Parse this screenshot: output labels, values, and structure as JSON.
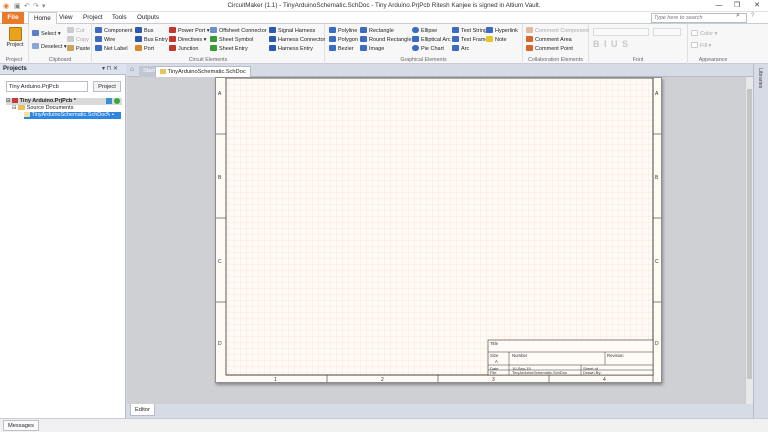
{
  "window": {
    "title": "CircuitMaker (1.1) - TinyArduinoSchematic.SchDoc - Tiny Arduino.PrjPcb Ritesh Kanjee is signed in Altium Vault.",
    "minimize": "—",
    "restore": "❐",
    "close": "✕"
  },
  "ribbon_tabs": {
    "file": "File",
    "home": "Home",
    "view": "View",
    "project": "Project",
    "tools": "Tools",
    "outputs": "Outputs"
  },
  "search": {
    "placeholder": "Type here to search"
  },
  "ribbon": {
    "project": {
      "label": "Project",
      "group": "Project"
    },
    "clipboard": {
      "select": "Select",
      "deselect": "Deselect",
      "cut": "Cut",
      "copy": "Copy",
      "paste": "Paste",
      "group": "Clipboard"
    },
    "circuit": {
      "component": "Component",
      "wire": "Wire",
      "net_label": "Net Label",
      "bus": "Bus",
      "bus_entry": "Bus Entry",
      "port": "Port",
      "power_port": "Power Port",
      "directives": "Directives",
      "junction": "Junction",
      "offsheet": "Offsheet Connector",
      "sheet_symbol": "Sheet Symbol",
      "sheet_entry": "Sheet Entry",
      "signal_harness": "Signal Harness",
      "harness_connector": "Harness Connector",
      "harness_entry": "Harness Entry",
      "group": "Circuit Elements"
    },
    "graphical": {
      "polyline": "Polyline",
      "polygon": "Polygon",
      "bezier": "Bezier",
      "rectangle": "Rectangle",
      "round_rectangle": "Round Rectangle",
      "image": "Image",
      "ellipse": "Ellipse",
      "elliptical_arc": "Elliptical Arc",
      "pie_chart": "Pie Chart",
      "text_string": "Text String",
      "text_frame": "Text Frame",
      "arc": "Arc",
      "hyperlink": "Hyperlink",
      "note": "Note",
      "group": "Graphical Elements"
    },
    "collab": {
      "comment_component": "Comment Component",
      "comment_area": "Comment Area",
      "comment_point": "Comment Point",
      "group": "Collaboration Elements"
    },
    "font": {
      "styles": "B I U S",
      "group": "Font"
    },
    "appearance": {
      "color": "Color",
      "fill": "Fill",
      "group": "Appearance"
    }
  },
  "projects_panel": {
    "title": "Projects",
    "pin": "▾ ⊓ ✕",
    "project_field": "Tiny Arduino.PrjPcb",
    "project_button": "Project",
    "tree": {
      "project": "Tiny Arduino.PrjPcb *",
      "folder": "Source Documents",
      "document": "TinyArduinoSchematic.SchDoc"
    }
  },
  "doc_tabs": {
    "start": "Start",
    "schematic": "TinyArduinoSchematic.SchDoc"
  },
  "sheet": {
    "zones_rows": [
      "A",
      "B",
      "C",
      "D"
    ],
    "zones_cols": [
      "1",
      "2",
      "3",
      "4"
    ],
    "title_block": {
      "title": "Title",
      "size_label": "Size",
      "size_value": "A",
      "number_label": "Number",
      "revision_label": "Revision",
      "date_label": "Date",
      "date_value": "10-Sep-15",
      "sheet_label": "Sheet   of",
      "file_label": "File",
      "file_value": "TinyArduinoSchematic.SchDoc",
      "drawn_label": "Drawn By:"
    }
  },
  "libraries_strip": "Libraries",
  "editor_tab": "Editor",
  "status": {
    "messages": "Messages"
  }
}
